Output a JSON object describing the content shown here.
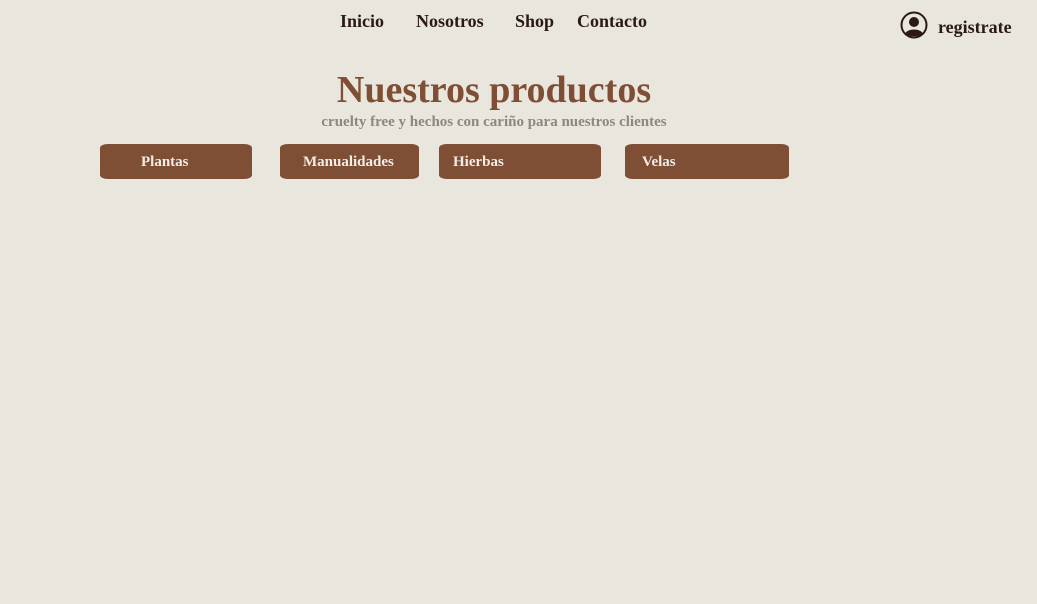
{
  "nav": {
    "items": [
      {
        "label": "Inicio"
      },
      {
        "label": "Nosotros"
      },
      {
        "label": "Shop"
      },
      {
        "label": "Contacto"
      }
    ],
    "register_label": "registrate",
    "register_icon": "user-avatar-icon"
  },
  "main": {
    "title": "Nuestros productos",
    "subtitle": "cruelty free y hechos con cariño para nuestros clientes"
  },
  "categories": [
    {
      "label": "Plantas"
    },
    {
      "label": "Manualidades"
    },
    {
      "label": "Hierbas"
    },
    {
      "label": "Velas"
    }
  ],
  "colors": {
    "background": "#e9e6de",
    "brand_brown": "#7f4f35",
    "nav_text": "#2b1a14",
    "subtitle_gray": "#8d8780",
    "button_text": "#f3ede6"
  }
}
